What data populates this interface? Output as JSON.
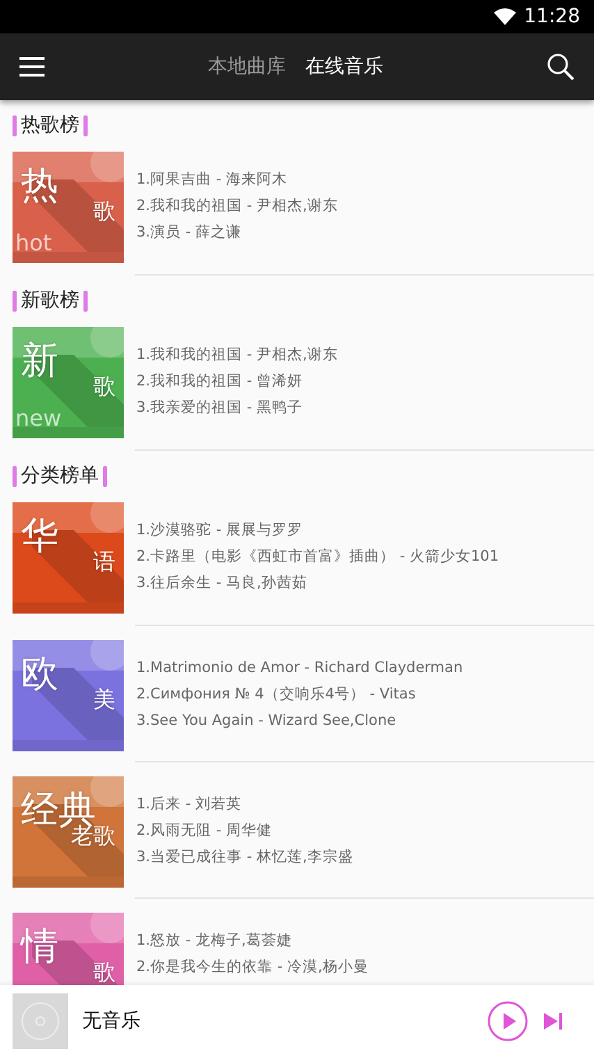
{
  "status_bar": {
    "time": "11:28"
  },
  "toolbar": {
    "tabs": [
      {
        "label": "本地曲库",
        "selected": false
      },
      {
        "label": "在线音乐",
        "selected": true
      }
    ]
  },
  "sections": [
    {
      "title": "热歌榜",
      "charts": [
        {
          "cover": {
            "big": "热",
            "small": "歌",
            "latin": "hot",
            "color": "#d9604a"
          },
          "tracks": [
            "1.阿果吉曲 - 海来阿木",
            "2.我和我的祖国 - 尹相杰,谢东",
            "3.演员 - 薛之谦"
          ]
        }
      ]
    },
    {
      "title": "新歌榜",
      "charts": [
        {
          "cover": {
            "big": "新",
            "small": "歌",
            "latin": "new",
            "color": "#4cb050"
          },
          "tracks": [
            "1.我和我的祖国 - 尹相杰,谢东",
            "2.我和我的祖国 - 曾浠妍",
            "3.我亲爱的祖国 - 黑鸭子"
          ]
        }
      ]
    },
    {
      "title": "分类榜单",
      "charts": [
        {
          "cover": {
            "big": "华",
            "small": "语",
            "color": "#dc4a1c"
          },
          "tracks": [
            "1.沙漠骆驼 - 展展与罗罗",
            "2.卡路里（电影《西虹市首富》插曲） - 火箭少女101",
            "3.往后余生 - 马良,孙茜茹"
          ]
        },
        {
          "cover": {
            "big": "欧",
            "small": "美",
            "color": "#7b72e0"
          },
          "tracks": [
            "1.Matrimonio de Amor - Richard Clayderman",
            "2.Симфония № 4（交响乐4号） - Vitas",
            "3.See You Again - Wizard See,Clone"
          ]
        },
        {
          "cover": {
            "big": "经典",
            "small": "老歌",
            "color": "#d0743a"
          },
          "tracks": [
            "1.后来 - 刘若英",
            "2.风雨无阻 - 周华健",
            "3.当爱已成往事 - 林忆莲,李宗盛"
          ]
        },
        {
          "cover": {
            "big": "情",
            "small": "歌",
            "color": "#e060a8"
          },
          "tracks": [
            "1.怒放 - 龙梅子,葛荟婕",
            "2.你是我今生的依靠 - 冷漠,杨小曼"
          ]
        }
      ]
    }
  ],
  "player": {
    "title": "无音乐"
  }
}
